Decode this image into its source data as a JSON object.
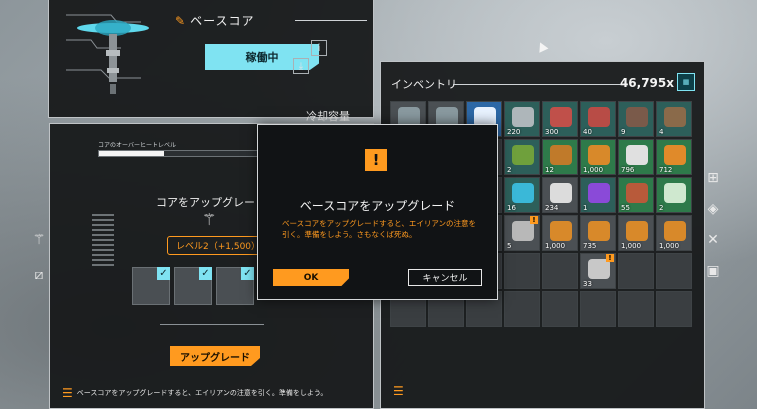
{
  "core": {
    "title": "ベースコア",
    "status": "稼働中",
    "cooling_label": "冷却容量"
  },
  "main": {
    "overheat_label": "コアのオーバーヒートレベル",
    "overheat_level": 0.3,
    "upgrade_heading": "コアをアップグレード",
    "level_badge": "レベル2（+1,500）",
    "upgrade_button": "アップグレード",
    "footer_note": "ベースコアをアップグレードすると、エイリアンの注意を引く。準備をしよう。"
  },
  "inventory": {
    "title": "インベントリ",
    "count": "46,795x",
    "count_icon": "credits-icon",
    "items": [
      {
        "qty": "300",
        "rarity": "gray",
        "color": "#8a9aa0"
      },
      {
        "qty": "40",
        "rarity": "gray",
        "color": "#8a9aa0"
      },
      {
        "qty": "",
        "rarity": "blue",
        "color": "#e8f2ff"
      },
      {
        "qty": "220",
        "rarity": "teal",
        "color": "#aeb6ba"
      },
      {
        "qty": "300",
        "rarity": "teal",
        "color": "#c0504a"
      },
      {
        "qty": "40",
        "rarity": "teal",
        "color": "#b84c46"
      },
      {
        "qty": "9",
        "rarity": "teal",
        "color": "#7a5a4a"
      },
      {
        "qty": "4",
        "rarity": "teal",
        "color": "#8a6a4a"
      },
      {
        "qty": "",
        "rarity": "empty",
        "color": "#3a3e41"
      },
      {
        "qty": "",
        "rarity": "empty",
        "color": "#3a3e41"
      },
      {
        "qty": "",
        "rarity": "empty",
        "color": "#3a3e41"
      },
      {
        "qty": "2",
        "rarity": "teal",
        "color": "#6fa03c"
      },
      {
        "qty": "12",
        "rarity": "green",
        "color": "#c07a2a"
      },
      {
        "qty": "1,000",
        "rarity": "green",
        "color": "#d8892a"
      },
      {
        "qty": "796",
        "rarity": "green",
        "color": "#e0e0e0"
      },
      {
        "qty": "712",
        "rarity": "green",
        "color": "#e08a2a"
      },
      {
        "qty": "",
        "rarity": "empty",
        "color": "#3a3e41"
      },
      {
        "qty": "",
        "rarity": "empty",
        "color": "#3a3e41"
      },
      {
        "qty": "",
        "rarity": "empty",
        "color": "#3a3e41"
      },
      {
        "qty": "16",
        "rarity": "teal",
        "color": "#3ab8d8"
      },
      {
        "qty": "234",
        "rarity": "gray",
        "color": "#dcdcdc"
      },
      {
        "qty": "1",
        "rarity": "teal",
        "color": "#8a4ad8"
      },
      {
        "qty": "55",
        "rarity": "green",
        "color": "#b85a3a"
      },
      {
        "qty": "2",
        "rarity": "green",
        "color": "#cfe8cf"
      },
      {
        "qty": "",
        "rarity": "empty",
        "color": "#3a3e41"
      },
      {
        "qty": "",
        "rarity": "empty",
        "color": "#3a3e41"
      },
      {
        "qty": "",
        "rarity": "empty",
        "color": "#3a3e41"
      },
      {
        "qty": "5",
        "rarity": "gray",
        "color": "#b8b8b8",
        "alert": "!"
      },
      {
        "qty": "1,000",
        "rarity": "gray",
        "color": "#d8892a"
      },
      {
        "qty": "735",
        "rarity": "gray",
        "color": "#d8892a"
      },
      {
        "qty": "1,000",
        "rarity": "gray",
        "color": "#d8892a"
      },
      {
        "qty": "1,000",
        "rarity": "gray",
        "color": "#d8892a"
      },
      {
        "qty": "",
        "rarity": "empty",
        "color": "#3a3e41"
      },
      {
        "qty": "",
        "rarity": "empty",
        "color": "#3a3e41"
      },
      {
        "qty": "",
        "rarity": "empty",
        "color": "#3a3e41"
      },
      {
        "qty": "",
        "rarity": "empty",
        "color": "#3a3e41"
      },
      {
        "qty": "",
        "rarity": "empty",
        "color": "#3a3e41"
      },
      {
        "qty": "33",
        "rarity": "gray",
        "color": "#c8c8c8",
        "alert": "!"
      },
      {
        "qty": "",
        "rarity": "empty",
        "color": "#3a3e41"
      },
      {
        "qty": "",
        "rarity": "empty",
        "color": "#3a3e41"
      },
      {
        "qty": "",
        "rarity": "empty",
        "color": "#3a3e41"
      },
      {
        "qty": "",
        "rarity": "empty",
        "color": "#3a3e41"
      },
      {
        "qty": "",
        "rarity": "empty",
        "color": "#3a3e41"
      },
      {
        "qty": "",
        "rarity": "empty",
        "color": "#3a3e41"
      },
      {
        "qty": "",
        "rarity": "empty",
        "color": "#3a3e41"
      },
      {
        "qty": "",
        "rarity": "empty",
        "color": "#3a3e41"
      },
      {
        "qty": "",
        "rarity": "empty",
        "color": "#3a3e41"
      },
      {
        "qty": "",
        "rarity": "empty",
        "color": "#3a3e41"
      }
    ]
  },
  "dialog": {
    "warn_glyph": "!",
    "title": "ベースコアをアップグレード",
    "body": "ベースコアをアップグレードすると、エイリアンの注意を引く。準備をしよう。さもなくば死ぬ。",
    "ok_label": "OK",
    "cancel_label": "キャンセル"
  },
  "colors": {
    "accent": "#ff9a1f",
    "cyan": "#7fe3f2"
  }
}
